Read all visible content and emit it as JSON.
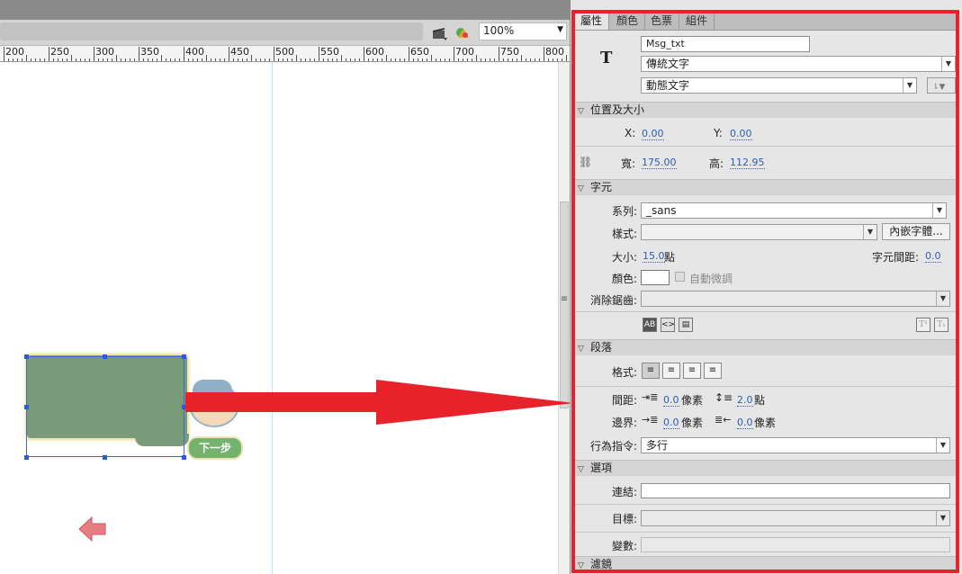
{
  "toolbar": {
    "zoom_value": "100%",
    "scene_icon": "clapperboard-icon",
    "symbol_icon": "shapes-icon"
  },
  "ruler": {
    "labels": [
      "200",
      "250",
      "300",
      "350",
      "400",
      "450",
      "500",
      "550",
      "600",
      "650",
      "700",
      "750",
      "800"
    ]
  },
  "stage": {
    "next_button_label": "下一步",
    "bubble_color": "#7a9b7a",
    "arrow_color": "#e8222a"
  },
  "panel": {
    "tabs": [
      "屬性",
      "顏色",
      "色票",
      "組件"
    ],
    "active_tab": "屬性",
    "instance_name": "Msg_txt",
    "text_type": "傳統文字",
    "text_subtype": "動態文字",
    "sections": {
      "position_size": "位置及大小",
      "character": "字元",
      "paragraph": "段落",
      "options": "選項",
      "filters": "濾鏡"
    },
    "position": {
      "x_label": "X:",
      "x_value": "0.00",
      "y_label": "Y:",
      "y_value": "0.00",
      "w_label": "寬:",
      "w_value": "175.00",
      "h_label": "高:",
      "h_value": "112.95"
    },
    "character": {
      "family_label": "系列:",
      "family_value": "_sans",
      "style_label": "樣式:",
      "style_value": "",
      "embed_button": "內嵌字體...",
      "size_label": "大小:",
      "size_value": "15.0",
      "size_unit": "點",
      "spacing_label": "字元間距:",
      "spacing_value": "0.0",
      "color_label": "顏色:",
      "color_value": "#ffffff",
      "autokern_label": "自動微調",
      "antialias_label": "消除鋸齒:",
      "antialias_value": ""
    },
    "paragraph": {
      "format_label": "格式:",
      "spacing_label": "間距:",
      "indent_value": "0.0",
      "indent_unit": "像素",
      "leading_value": "2.0",
      "leading_unit": "點",
      "margin_label": "邊界:",
      "left_margin_value": "0.0",
      "left_margin_unit": "像素",
      "right_margin_value": "0.0",
      "right_margin_unit": "像素",
      "behavior_label": "行為指令:",
      "behavior_value": "多行"
    },
    "options": {
      "link_label": "連結:",
      "link_value": "",
      "target_label": "目標:",
      "target_value": "",
      "variable_label": "變數:",
      "variable_value": ""
    },
    "highlight_color": "#e8222a"
  }
}
